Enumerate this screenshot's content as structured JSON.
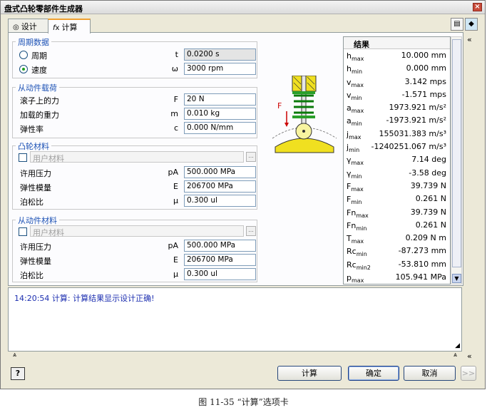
{
  "window": {
    "title": "盘式凸轮零部件生成器",
    "close_glyph": "×"
  },
  "tabs": [
    {
      "label": "设计",
      "icon": "design-tab-icon"
    },
    {
      "label": "计算",
      "icon": "calculation-tab-icon",
      "active": true
    }
  ],
  "top_icons": [
    "export-icon",
    "eraser-icon"
  ],
  "period_group": {
    "title": "周期数据",
    "period": {
      "label": "周期",
      "symbol": "t",
      "value": "0.0200 s",
      "selected": false
    },
    "speed": {
      "label": "速度",
      "symbol": "ω",
      "value": "3000 rpm",
      "selected": true
    }
  },
  "follower_load": {
    "title": "从动件载荷",
    "rows": [
      {
        "label": "滚子上的力",
        "symbol": "F",
        "value": "20 N"
      },
      {
        "label": "加载的重力",
        "symbol": "m",
        "value": "0.010 kg"
      },
      {
        "label": "弹性率",
        "symbol": "c",
        "value": "0.000 N/mm"
      }
    ]
  },
  "cam_material": {
    "title": "凸轮材料",
    "user_material": "用户材料",
    "rows": [
      {
        "label": "许用压力",
        "symbol": "pA",
        "value": "500.000 MPa"
      },
      {
        "label": "弹性模量",
        "symbol": "E",
        "value": "206700 MPa"
      },
      {
        "label": "泊松比",
        "symbol": "μ",
        "value": "0.300 ul"
      }
    ]
  },
  "follower_material": {
    "title": "从动件材料",
    "user_material": "用户材料",
    "rows": [
      {
        "label": "许用压力",
        "symbol": "pA",
        "value": "500.000 MPa"
      },
      {
        "label": "弹性模量",
        "symbol": "E",
        "value": "206700 MPa"
      },
      {
        "label": "泊松比",
        "symbol": "μ",
        "value": "0.300 ul"
      }
    ]
  },
  "diagram": {
    "force_label": "F"
  },
  "results": {
    "title": "结果",
    "rows": [
      {
        "name": "h",
        "sub": "max",
        "value": "10.000 mm"
      },
      {
        "name": "h",
        "sub": "min",
        "value": "0.000 mm"
      },
      {
        "name": "v",
        "sub": "max",
        "value": "3.142 mps"
      },
      {
        "name": "v",
        "sub": "min",
        "value": "-1.571 mps"
      },
      {
        "name": "a",
        "sub": "max",
        "value": "1973.921 m/s²"
      },
      {
        "name": "a",
        "sub": "min",
        "value": "-1973.921 m/s²"
      },
      {
        "name": "j",
        "sub": "max",
        "value": "155031.383 m/s³"
      },
      {
        "name": "j",
        "sub": "min",
        "value": "-1240251.067 m/s³"
      },
      {
        "name": "γ",
        "sub": "max",
        "value": "7.14 deg"
      },
      {
        "name": "γ",
        "sub": "min",
        "value": "-3.58 deg"
      },
      {
        "name": "F",
        "sub": "max",
        "value": "39.739 N"
      },
      {
        "name": "F",
        "sub": "min",
        "value": "0.261 N"
      },
      {
        "name": "Fn",
        "sub": "max",
        "value": "39.739 N"
      },
      {
        "name": "Fn",
        "sub": "min",
        "value": "0.261 N"
      },
      {
        "name": "T",
        "sub": "max",
        "value": "0.209 N m"
      },
      {
        "name": "Rc",
        "sub": "min",
        "value": "-87.273 mm"
      },
      {
        "name": "Rc",
        "sub": "min2",
        "value": "-53.810 mm"
      },
      {
        "name": "p",
        "sub": "max",
        "value": "105.941 MPa"
      }
    ]
  },
  "message": "14:20:54 计算: 计算结果显示设计正确!",
  "buttons": {
    "calculate": "计算",
    "ok": "确定",
    "cancel": "取消",
    "more": ">>",
    "help": "?"
  },
  "caption": "图 11-35  “计算”选项卡"
}
